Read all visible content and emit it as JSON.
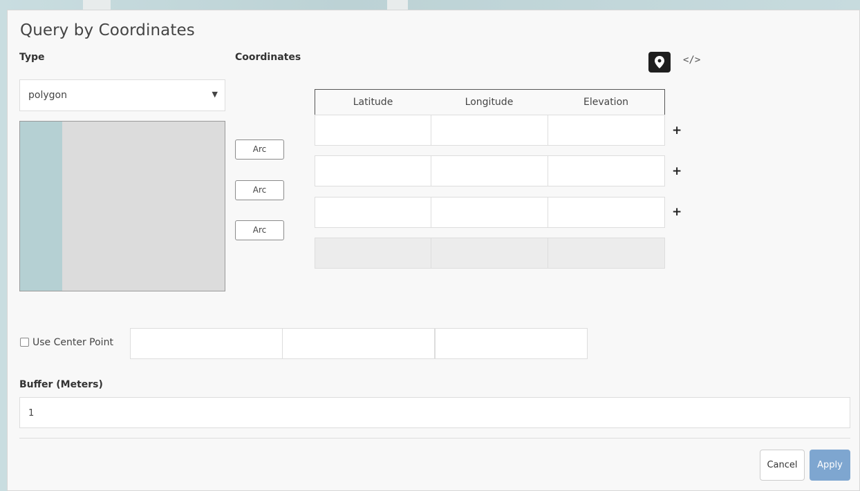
{
  "dialog": {
    "title": "Query by Coordinates",
    "type_label": "Type",
    "coordinates_label": "Coordinates",
    "type_select": {
      "value": "polygon"
    },
    "arc_buttons": [
      "Arc",
      "Arc",
      "Arc"
    ],
    "table": {
      "headers": [
        "Latitude",
        "Longitude",
        "Elevation"
      ],
      "add_label": "+"
    },
    "center_point": {
      "label": "Use Center Point",
      "checked": false
    },
    "buffer": {
      "label": "Buffer (Meters)",
      "value": "1"
    },
    "buttons": {
      "cancel": "Cancel",
      "apply": "Apply"
    },
    "icons": {
      "marker": "map-marker-icon",
      "code": "</>"
    }
  },
  "colors": {
    "apply_button": "#7ea6d0",
    "preview_map": "#b5d0d3",
    "preview_bg": "#dcdcdc"
  }
}
